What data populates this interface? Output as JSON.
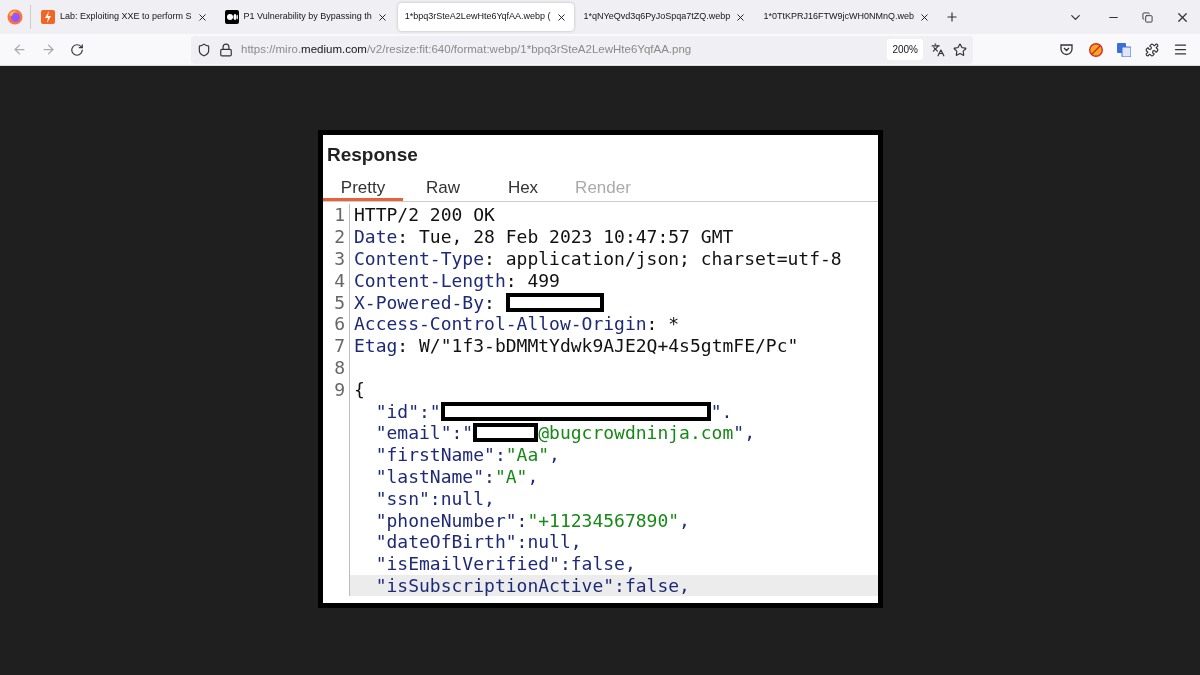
{
  "browser": {
    "tabs": [
      {
        "title": "Lab: Exploiting XXE to perform S",
        "kind": "lightning",
        "selected": false
      },
      {
        "title": "P1 Vulnerability by Bypassing th",
        "kind": "dots",
        "selected": false
      },
      {
        "title": "1*bpq3rSteA2LewHte6YqfAA.webp (",
        "kind": "plain",
        "selected": true
      },
      {
        "title": "1*qNYeQvd3q6PyJoSpqa7tZQ.webp",
        "kind": "plain",
        "selected": false
      },
      {
        "title": "1*0TtKPRJ16FTW9jcWH0NMnQ.web",
        "kind": "plain",
        "selected": false
      }
    ],
    "url": {
      "prefix": "https://miro.",
      "domain": "medium.com",
      "suffix": "/v2/resize:fit:640/format:webp/1*bpq3rSteA2LewHte6YqfAA.png"
    },
    "zoom": "200%"
  },
  "image": {
    "title": "Response",
    "tabs": [
      {
        "label": "Pretty",
        "selected": true,
        "disabled": false
      },
      {
        "label": "Raw",
        "selected": false,
        "disabled": false
      },
      {
        "label": "Hex",
        "selected": false,
        "disabled": false
      },
      {
        "label": "Render",
        "selected": false,
        "disabled": true
      }
    ],
    "lines": [
      {
        "number": "1",
        "tokens": [
          {
            "kind": "plain",
            "text": "HTTP/2 200 OK"
          }
        ]
      },
      {
        "number": "2",
        "tokens": [
          {
            "kind": "key",
            "text": "Date"
          },
          {
            "kind": "plain",
            "text": ": Tue, 28 Feb 2023 10:47:57 GMT"
          }
        ]
      },
      {
        "number": "3",
        "tokens": [
          {
            "kind": "key",
            "text": "Content-Type"
          },
          {
            "kind": "plain",
            "text": ": application/json; charset=utf-8"
          }
        ]
      },
      {
        "number": "4",
        "tokens": [
          {
            "kind": "key",
            "text": "Content-Length"
          },
          {
            "kind": "plain",
            "text": ": 499"
          }
        ]
      },
      {
        "number": "5",
        "tokens": [
          {
            "kind": "key",
            "text": "X-Powered-By"
          },
          {
            "kind": "plain",
            "text": ": "
          },
          {
            "kind": "blank"
          }
        ]
      },
      {
        "number": "6",
        "tokens": [
          {
            "kind": "key",
            "text": "Access-Control-Allow-Origin"
          },
          {
            "kind": "plain",
            "text": ": *"
          }
        ]
      },
      {
        "number": "7",
        "tokens": [
          {
            "kind": "key",
            "text": "Etag"
          },
          {
            "kind": "plain",
            "text": ": W/\"1f3-bDMMtYdwk9AJE2Q+4s5gtmFE/Pc\""
          }
        ]
      },
      {
        "number": "8"
      },
      {
        "number": "9",
        "tokens": [
          {
            "kind": "plain",
            "text": "{"
          }
        ]
      },
      {
        "tokens": [
          {
            "kind": "key",
            "text": "  \"id\":\""
          },
          {
            "kind": "longblank"
          },
          {
            "kind": "key",
            "text": "\"."
          }
        ]
      },
      {
        "tokens": [
          {
            "kind": "key",
            "text": "  \"email\":\""
          },
          {
            "kind": "shortblank"
          },
          {
            "kind": "string",
            "text": "@bugcrowdninja.com"
          },
          {
            "kind": "key",
            "text": "\","
          }
        ]
      },
      {
        "tokens": [
          {
            "kind": "key",
            "text": "  \"firstName\":"
          },
          {
            "kind": "string",
            "text": "\"Aa\""
          },
          {
            "kind": "key",
            "text": ","
          }
        ]
      },
      {
        "tokens": [
          {
            "kind": "key",
            "text": "  \"lastName\":"
          },
          {
            "kind": "string",
            "text": "\"A\""
          },
          {
            "kind": "key",
            "text": ","
          }
        ]
      },
      {
        "tokens": [
          {
            "kind": "key",
            "text": "  \"ssn\":null,"
          }
        ]
      },
      {
        "tokens": [
          {
            "kind": "key",
            "text": "  \"phoneNumber\":"
          },
          {
            "kind": "string",
            "text": "\"+11234567890\""
          },
          {
            "kind": "key",
            "text": ","
          }
        ]
      },
      {
        "tokens": [
          {
            "kind": "key",
            "text": "  \"dateOfBirth\":null,"
          }
        ]
      },
      {
        "tokens": [
          {
            "kind": "key",
            "text": "  \"isEmailVerified\":false,"
          }
        ]
      },
      {
        "highlighted": true,
        "tokens": [
          {
            "kind": "key",
            "text": "  \"isSubscriptionActive\":false,"
          }
        ]
      }
    ]
  }
}
